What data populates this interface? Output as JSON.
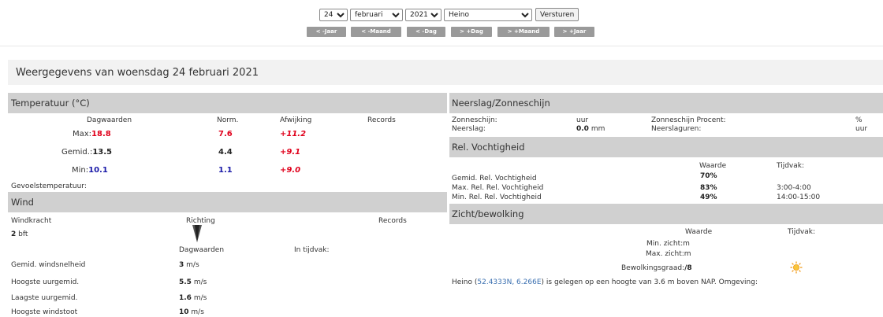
{
  "controls": {
    "day": "24",
    "month": "februari",
    "year": "2021",
    "station": "Heino",
    "submit_label": "Versturen",
    "nav": [
      "< -Jaar",
      "< -Maand",
      "< -Dag",
      "> +Dag",
      "> +Maand",
      "> +Jaar"
    ]
  },
  "page_title": "Weergegevens van woensdag 24 februari 2021",
  "temperature": {
    "heading": "Temperatuur (°C)",
    "col_day": "Dagwaarden",
    "col_norm": "Norm.",
    "col_dev": "Afwijking",
    "col_rec": "Records",
    "max_label": "Max:",
    "max_value": "18.8",
    "max_norm": "7.6",
    "max_dev": "+11.2",
    "avg_label": "Gemid.:",
    "avg_value": "13.5",
    "avg_norm": "4.4",
    "avg_dev": "+9.1",
    "min_label": "Min:",
    "min_value": "10.1",
    "min_norm": "1.1",
    "min_dev": "+9.0",
    "feels_label": "Gevoelstemperatuur:"
  },
  "wind": {
    "heading": "Wind",
    "col_force": "Windkracht",
    "col_dir": "Richting",
    "col_rec": "Records",
    "force_value": "2",
    "force_unit": "bft",
    "col_day": "Dagwaarden",
    "col_period": "In tijdvak:",
    "rows": [
      {
        "label": "Gemid. windsnelheid",
        "value": "3",
        "unit": "m/s"
      },
      {
        "label": "Hoogste uurgemid.",
        "value": "5.5",
        "unit": "m/s"
      },
      {
        "label": "Laagste uurgemid.",
        "value": "1.6",
        "unit": "m/s"
      },
      {
        "label": "Hoogste windstoot",
        "value": "10",
        "unit": "m/s"
      }
    ]
  },
  "precip": {
    "heading": "Neerslag/Zonneschijn",
    "sun_label": "Zonneschijn:",
    "sun_unit": "uur",
    "sun_pct_label": "Zonneschijn Procent:",
    "pct_unit": "%",
    "rain_label": "Neerslag:",
    "rain_value": "0.0",
    "rain_unit": "mm",
    "rain_hours_label": "Neerslaguren:",
    "hours_unit": "uur"
  },
  "humidity": {
    "heading": "Rel. Vochtigheid",
    "col_value": "Waarde",
    "col_period": "Tijdvak:",
    "rows": [
      {
        "label": "Gemid. Rel. Vochtigheid",
        "value": "70%",
        "period": ""
      },
      {
        "label": "Max. Rel. Rel. Vochtigheid",
        "value": "83%",
        "period": "3:00-4:00"
      },
      {
        "label": "Min. Rel. Rel. Vochtigheid",
        "value": "49%",
        "period": "14:00-15:00"
      }
    ]
  },
  "visibility": {
    "heading": "Zicht/bewolking",
    "col_value": "Waarde",
    "col_period": "Tijdvak:",
    "min_label": "Min. zicht:m",
    "max_label": "Max. zicht:m",
    "cloud_label": "Bewolkingsgraad:",
    "cloud_value": "/8",
    "cloud_icon": "sun-icon"
  },
  "location": {
    "prefix": "Heino (",
    "coords": "52.4333N, 6.266E",
    "suffix": ") is gelegen op een hoogte van 3.6 m boven NAP. Omgeving:"
  }
}
